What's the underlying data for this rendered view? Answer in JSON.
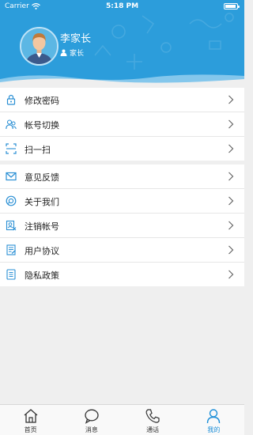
{
  "status_bar": {
    "carrier": "Carrier",
    "time": "5:18 PM"
  },
  "profile": {
    "name": "李家长",
    "role": "家长"
  },
  "menu_group_1": [
    {
      "label": "修改密码",
      "icon": "lock-icon"
    },
    {
      "label": "帐号切换",
      "icon": "switch-account-icon"
    },
    {
      "label": "扫一扫",
      "icon": "scan-icon"
    }
  ],
  "menu_group_2": [
    {
      "label": "意见反馈",
      "icon": "mail-icon"
    },
    {
      "label": "关于我们",
      "icon": "info-icon"
    },
    {
      "label": "注销帐号",
      "icon": "close-account-icon"
    },
    {
      "label": "用户协议",
      "icon": "agreement-icon"
    },
    {
      "label": "隐私政策",
      "icon": "privacy-icon"
    }
  ],
  "tabbar": [
    {
      "label": "首页",
      "icon": "home-icon",
      "active": false
    },
    {
      "label": "消息",
      "icon": "message-icon",
      "active": false
    },
    {
      "label": "通话",
      "icon": "phone-icon",
      "active": false
    },
    {
      "label": "我的",
      "icon": "profile-icon",
      "active": true
    }
  ],
  "colors": {
    "header": "#2c9ddb",
    "accent": "#1d8fd8",
    "background": "#efefef"
  }
}
